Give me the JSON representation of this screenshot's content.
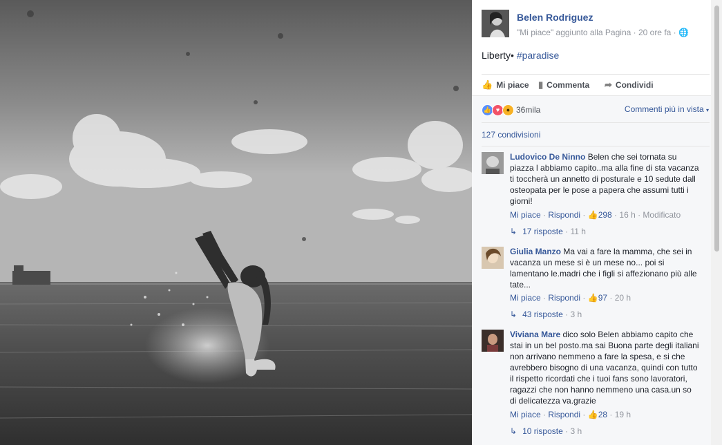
{
  "post": {
    "page_name": "Belen Rodriguez",
    "meta": "\"Mi piace\" aggiunto alla Pagina · 20 ore fa ·",
    "text_main": "Liberty•",
    "text_hashtag": "#paradise",
    "menu_icon": "chevron-down-icon",
    "privacy_icon": "globe-icon"
  },
  "actions": {
    "like": "Mi piace",
    "comment": "Commenta",
    "share": "Condividi"
  },
  "reactions": {
    "icons": [
      "like-icon",
      "love-icon",
      "wow-icon"
    ],
    "count": "36mila",
    "order_label": "Commenti più in vista"
  },
  "shares": "127 condivisioni",
  "comments": [
    {
      "author": "Ludovico De Ninno",
      "text": "Belen che sei tornata su piazza l abbiamo capito..ma alla fine di sta vacanza ti toccherà un annetto di posturale e 10 sedute dall osteopata per le pose a papera che assumi tutti i giorni!",
      "like_label": "Mi piace",
      "reply_label": "Rispondi",
      "likes": "298",
      "time": "16 h",
      "edited": "Modificato",
      "replies_label": "17 risposte",
      "replies_time": "11 h"
    },
    {
      "author": "Giulia Manzo",
      "text": "Ma vai a fare la mamma, che sei in vacanza un mese si è un mese no... poi si lamentano le.madri che i figli si affezionano più alle tate...",
      "like_label": "Mi piace",
      "reply_label": "Rispondi",
      "likes": "97",
      "time": "20 h",
      "replies_label": "43 risposte",
      "replies_time": "3 h"
    },
    {
      "author": "Viviana Mare",
      "text": "dico solo Belen abbiamo capito che stai in un bel posto.ma sai Buona parte degli italiani non arrivano nemmeno a fare la spesa, e si che avrebbero bisogno di una vacanza, quindi con tutto il rispetto ricordati che i tuoi fans sono lavoratori, ragazzi che non hanno nemmeno una casa.un so di delicatezza va.grazie",
      "like_label": "Mi piace",
      "reply_label": "Rispondi",
      "likes": "28",
      "time": "19 h",
      "replies_label": "10 risposte",
      "replies_time": "3 h"
    }
  ]
}
